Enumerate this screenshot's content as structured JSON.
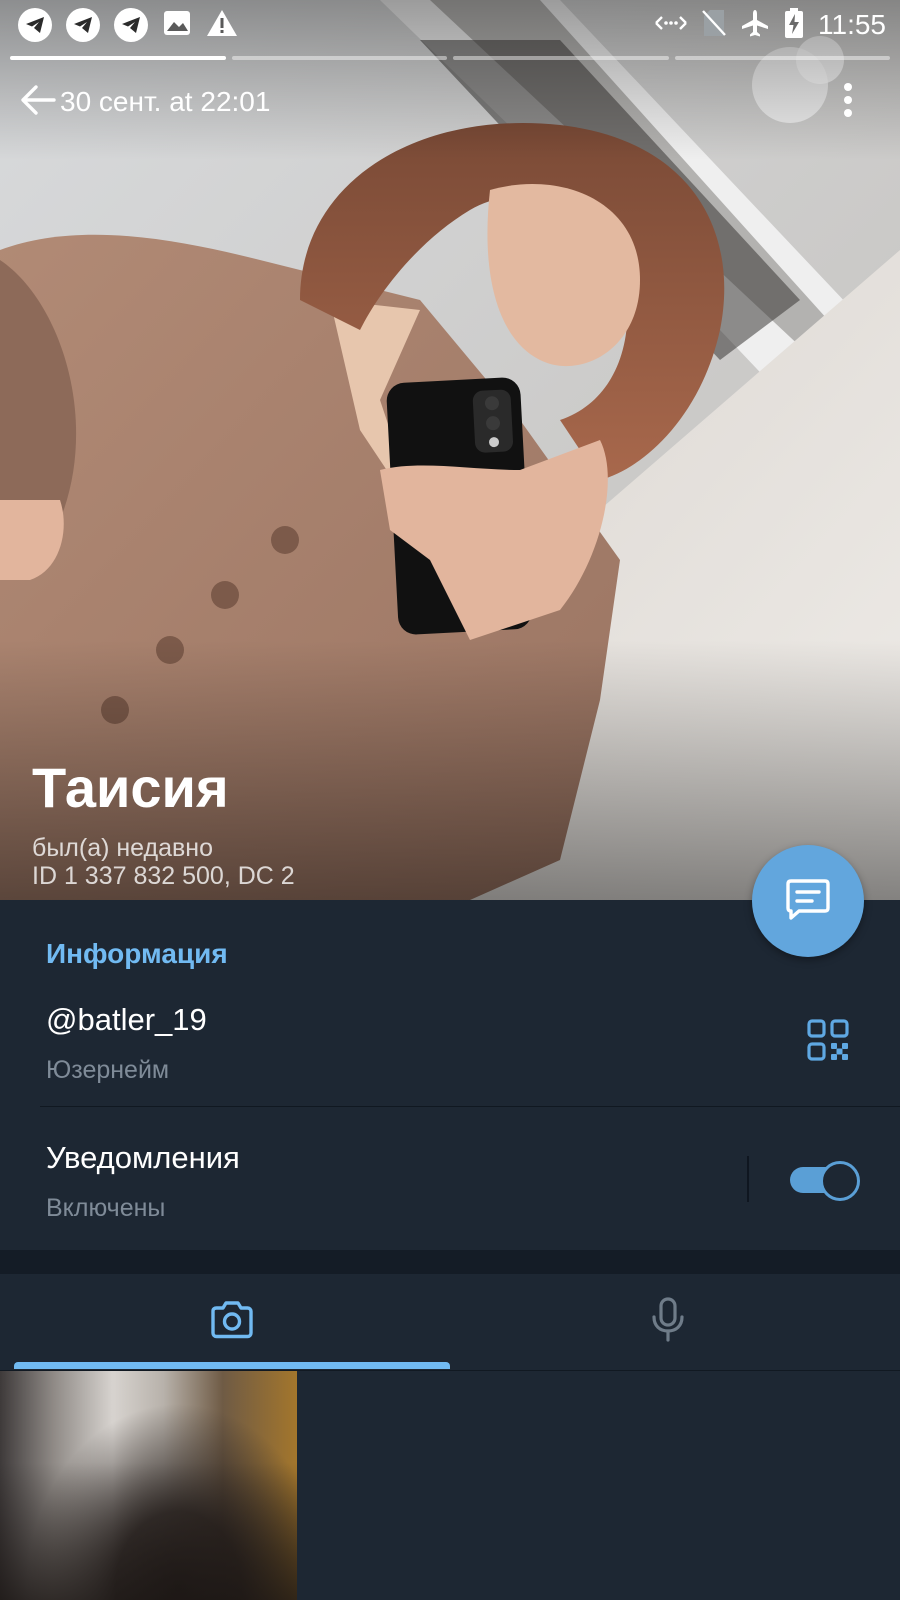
{
  "status_bar": {
    "time": "11:55",
    "notification_icons": [
      "telegram-icon",
      "telegram-icon",
      "telegram-icon",
      "image-icon",
      "warning-icon"
    ],
    "system_icons": [
      "data-arrows-icon",
      "no-sim-icon",
      "airplane-icon",
      "battery-charging-icon"
    ]
  },
  "story": {
    "segments": 4,
    "active_segment": 1
  },
  "top_bar": {
    "date": "30 сент. at 22:01",
    "back_icon": "arrow-left-icon",
    "menu_icon": "more-vert-icon"
  },
  "profile": {
    "name": "Таисия",
    "last_seen": "был(а) недавно",
    "id_line": "ID 1 337 832 500, DC 2"
  },
  "fab": {
    "icon": "message-icon"
  },
  "info": {
    "title": "Информация",
    "username_value": "@batler_19",
    "username_label": "Юзернейм",
    "qr_icon": "qr-code-icon",
    "notifications_label": "Уведомления",
    "notifications_status": "Включены",
    "notifications_enabled": true
  },
  "tabs": {
    "items": [
      "camera-icon",
      "microphone-icon"
    ],
    "active_index": 0
  },
  "colors": {
    "background": "#1d2733",
    "accent": "#71baf2",
    "fab": "#62a6dd",
    "secondary_text": "#7f8b98"
  }
}
